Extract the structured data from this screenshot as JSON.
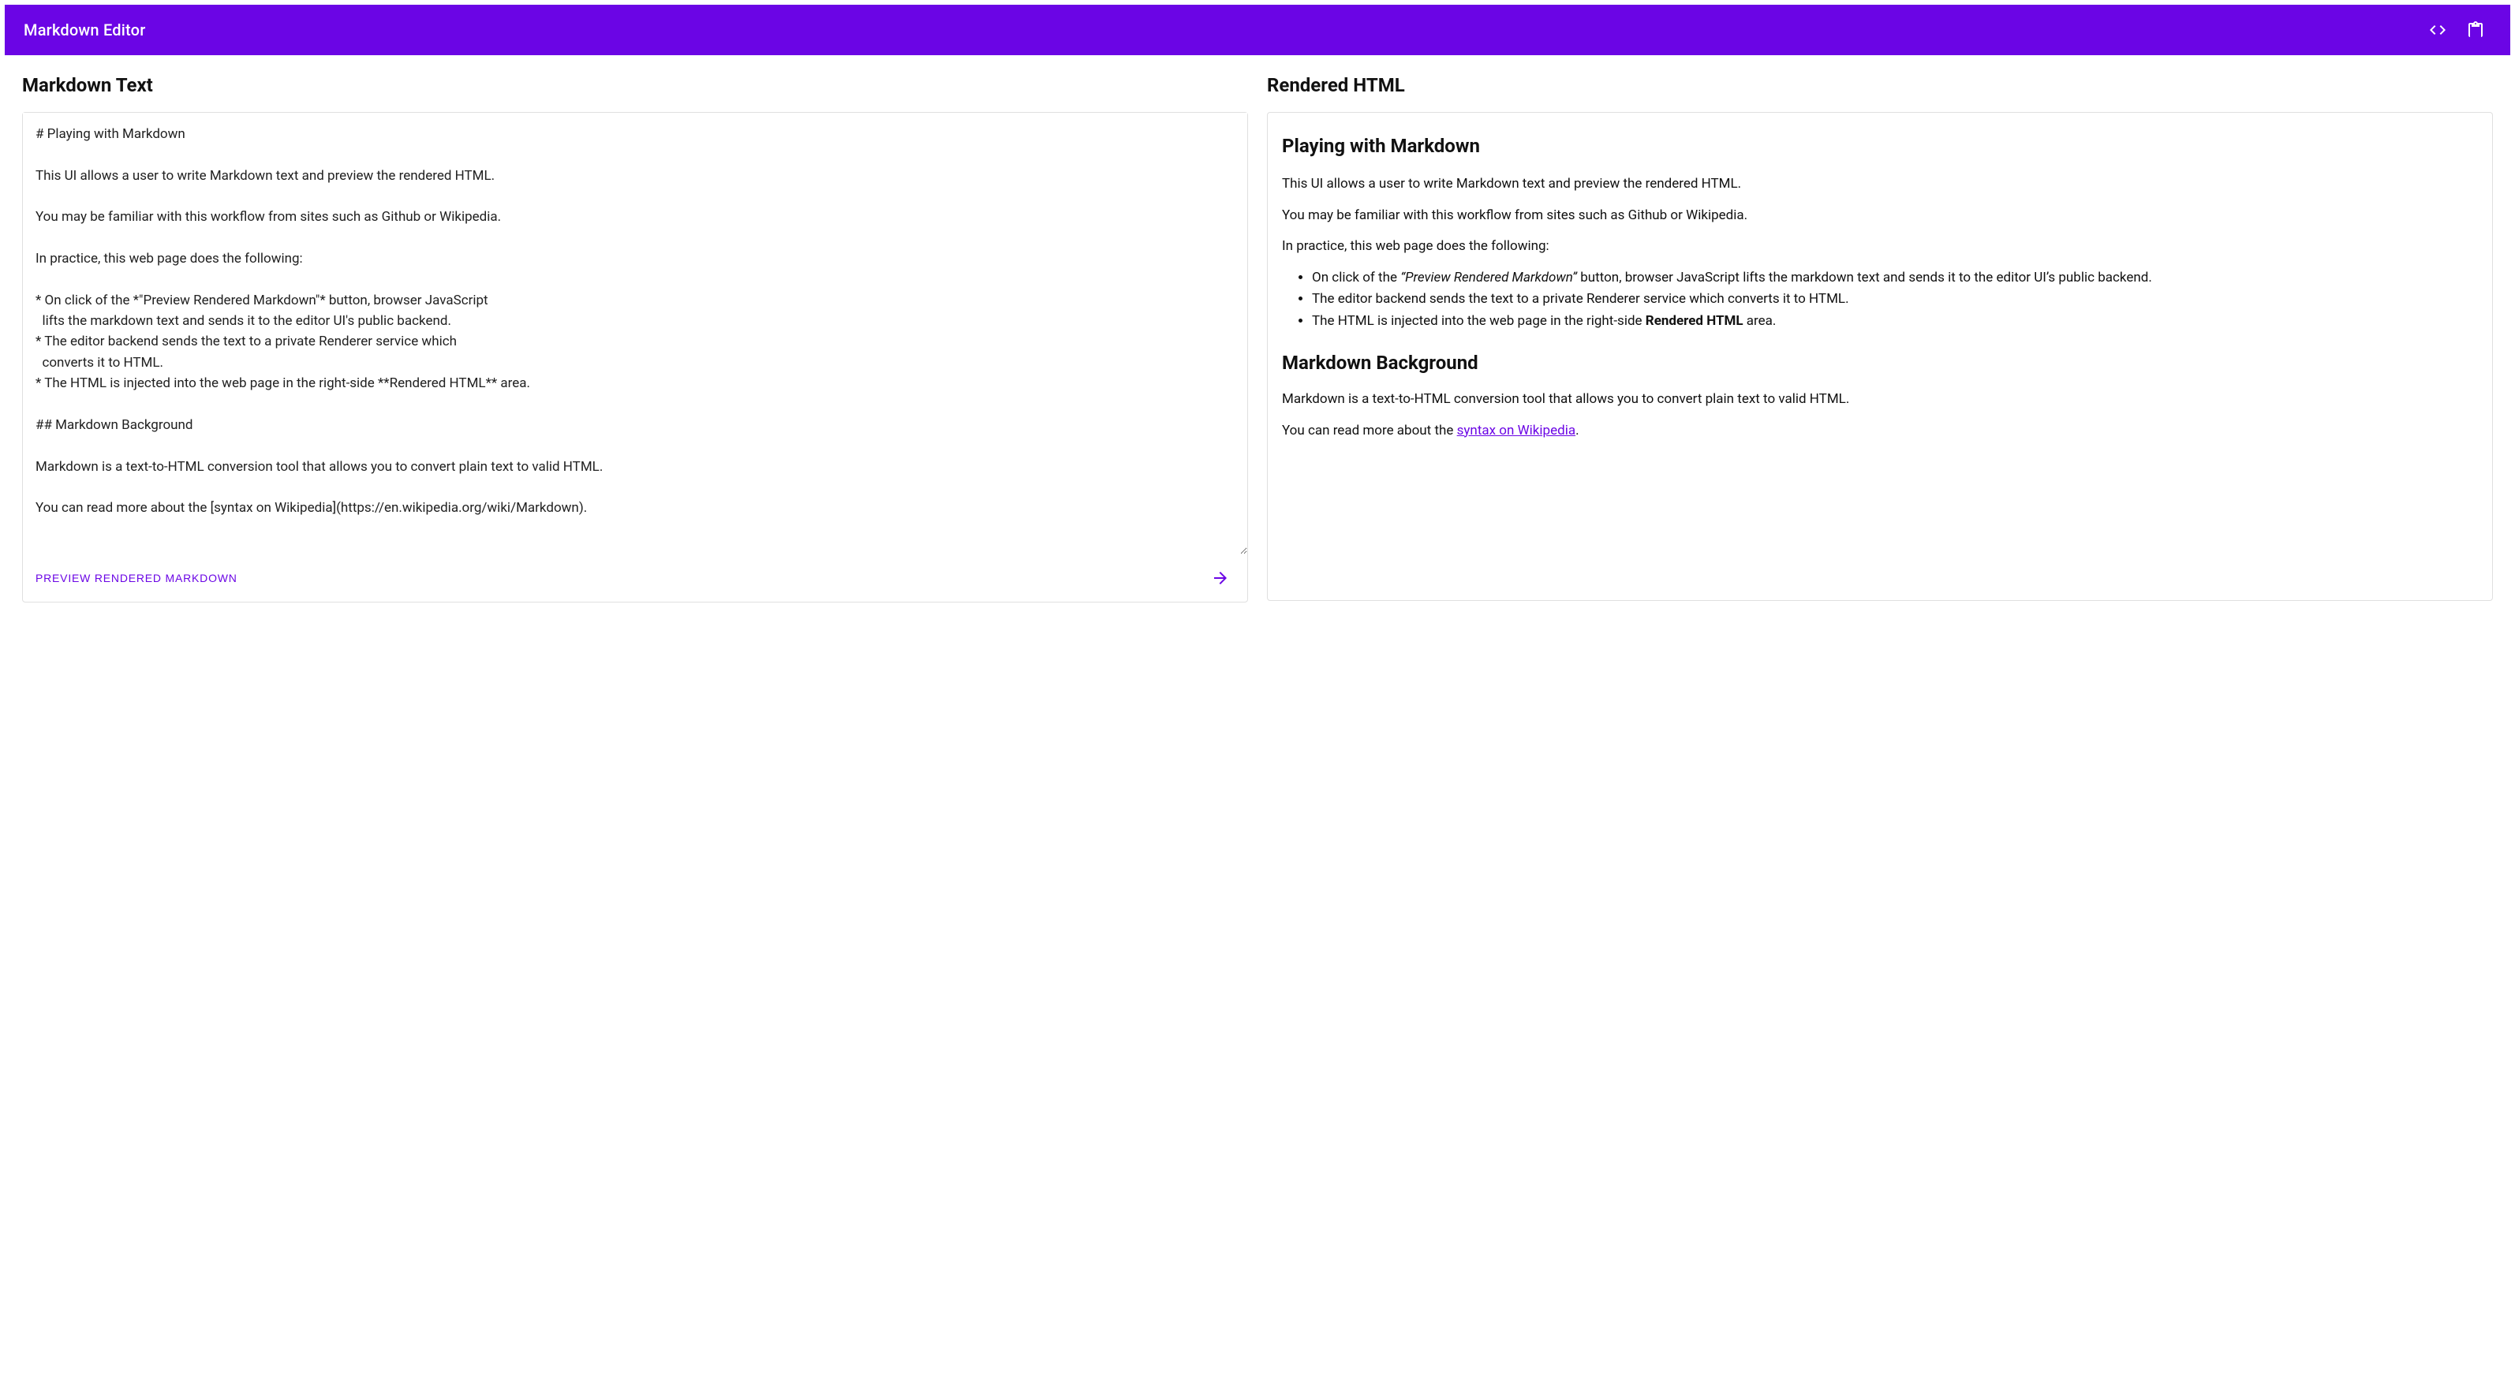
{
  "header": {
    "title": "Markdown Editor",
    "icons": {
      "code": "code-icon",
      "clipboard": "clipboard-icon"
    }
  },
  "left": {
    "heading": "Markdown Text",
    "textarea_value": "# Playing with Markdown\n\nThis UI allows a user to write Markdown text and preview the rendered HTML.\n\nYou may be familiar with this workflow from sites such as Github or Wikipedia.\n\nIn practice, this web page does the following:\n\n* On click of the *\"Preview Rendered Markdown\"* button, browser JavaScript\n  lifts the markdown text and sends it to the editor UI's public backend.\n* The editor backend sends the text to a private Renderer service which\n  converts it to HTML.\n* The HTML is injected into the web page in the right-side **Rendered HTML** area.\n\n## Markdown Background\n\nMarkdown is a text-to-HTML conversion tool that allows you to convert plain text to valid HTML.\n\nYou can read more about the [syntax on Wikipedia](https://en.wikipedia.org/wiki/Markdown).",
    "preview_button_label": "PREVIEW RENDERED MARKDOWN"
  },
  "right": {
    "heading": "Rendered HTML",
    "h1": "Playing with Markdown",
    "p1": "This UI allows a user to write Markdown text and preview the rendered HTML.",
    "p2": "You may be familiar with this workflow from sites such as Github or Wikipedia.",
    "p3": "In practice, this web page does the following:",
    "list": {
      "li1_pre": "On click of the ",
      "li1_em": "“Preview Rendered Markdown”",
      "li1_post": " button, browser JavaScript lifts the markdown text and sends it to the editor UI’s public backend.",
      "li2": "The editor backend sends the text to a private Renderer service which converts it to HTML.",
      "li3_pre": "The HTML is injected into the web page in the right-side ",
      "li3_strong": "Rendered HTML",
      "li3_post": " area."
    },
    "h2": "Markdown Background",
    "p4": "Markdown is a text-to-HTML conversion tool that allows you to convert plain text to valid HTML.",
    "p5_pre": "You can read more about the ",
    "p5_link_text": "syntax on Wikipedia",
    "p5_post": "."
  }
}
